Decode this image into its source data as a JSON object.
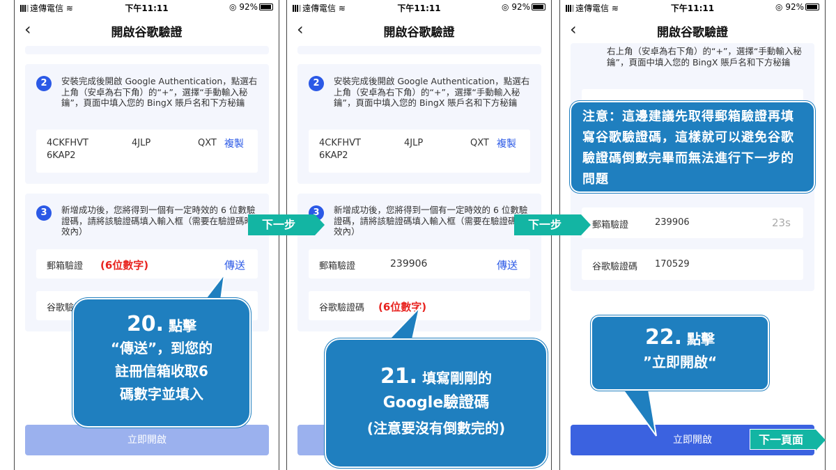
{
  "status": {
    "carrier": "遠傳電信",
    "time": "下午11:11",
    "battery": "92%"
  },
  "nav": {
    "back": "‹",
    "title": "開啟谷歌驗證"
  },
  "step2": {
    "num": "2",
    "text": "安裝完成後開啟 Google Authentication，點選右上角（安卓為右下角）的“+”，選擇“手動輸入秘鑰”，頁面中填入您的 BingX 賬戶名和下方秘鑰",
    "key_line1_a": "4CKFHVT",
    "key_line1_b": "4JLP",
    "key_line1_c": "QXT",
    "key_line2": "6KAP2",
    "copy": "複製"
  },
  "step3": {
    "num": "3",
    "text": "新增成功後，您將得到一個有一定時效的 6 位數驗證碼，請將該驗證碼填入輸入框（需要在驗證碼時效內）"
  },
  "email_label": "郵箱驗證",
  "google_label": "谷歌驗證碼",
  "send": "傳送",
  "email_code": "239906",
  "google_code": "170529",
  "countdown": "23s",
  "hint_digits": "(6位數字)",
  "enable_button": "立即開啟",
  "p3_partial_text": "右上角（安卓為右下角）的“+”，選擇“手動輸入秘鑰”，頁面中填入您的 BingX 賬戶名和下方秘鑰",
  "callouts": {
    "c20_num": "20.",
    "c20_a": "點擊",
    "c20_b": "“傳送”，到您的",
    "c20_c": "註冊信箱收取6",
    "c20_d": "碼數字並填入",
    "c21_num": "21.",
    "c21_a": "填寫剛剛的",
    "c21_b": "Google驗證碼",
    "c21_c": "(注意要沒有倒數完的)",
    "c22_num": "22.",
    "c22_a": "點擊",
    "c22_b": "”立即開啟“",
    "note": "注意：這邊建議先取得郵箱驗證再填寫谷歌驗證碼，這樣就可以避免谷歌驗證碼倒數完畢而無法進行下一步的問題"
  },
  "next_step": "下一步",
  "next_page": "下一頁面",
  "colors": {
    "accent": "#2b59e6",
    "callout": "#1f7fbf",
    "arrow": "#13b5a3",
    "red": "#e8231f"
  }
}
